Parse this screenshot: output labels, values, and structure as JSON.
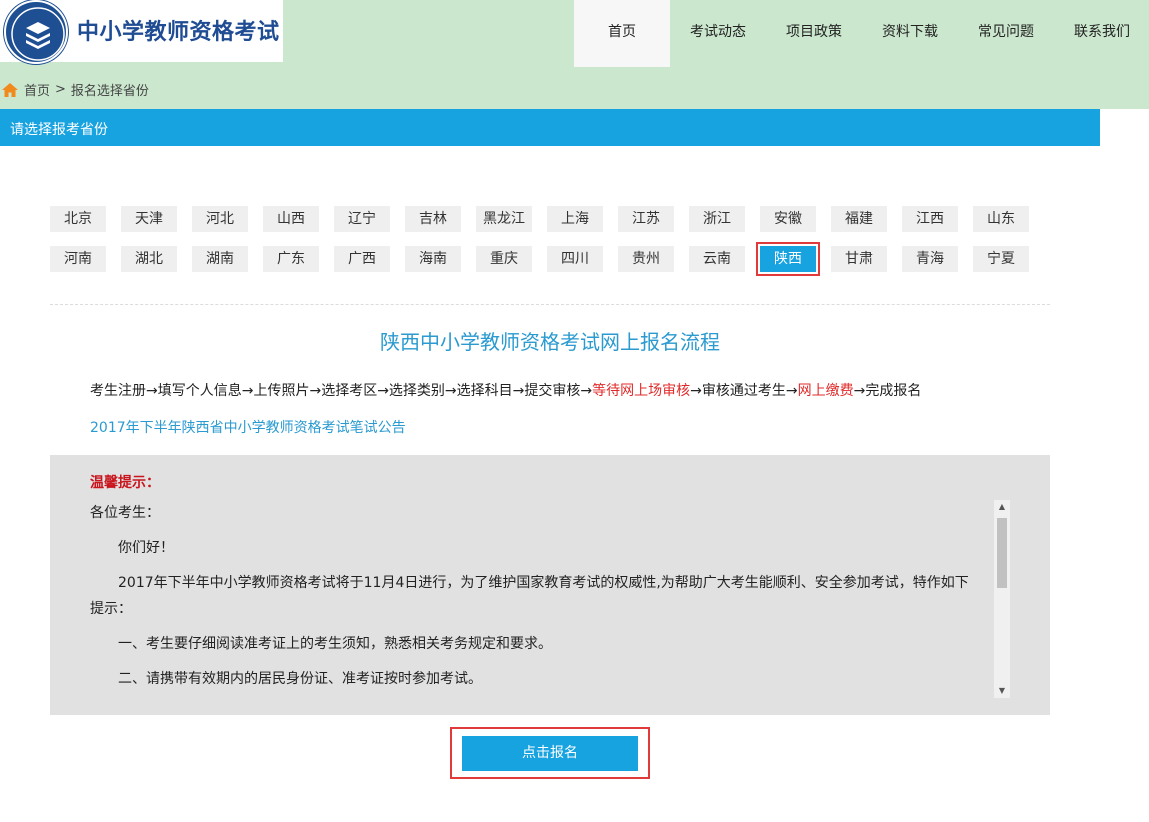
{
  "header": {
    "site_title": "中小学教师资格考试",
    "nav": [
      "首页",
      "考试动态",
      "项目政策",
      "资料下载",
      "常见问题",
      "联系我们"
    ],
    "active_nav": "首页"
  },
  "breadcrumb": {
    "home": "首页",
    "separator": ">",
    "current": "报名选择省份"
  },
  "section_title": "请选择报考省份",
  "provinces": {
    "row1": [
      "北京",
      "天津",
      "河北",
      "山西",
      "辽宁",
      "吉林",
      "黑龙江",
      "上海",
      "江苏",
      "浙江",
      "安徽",
      "福建",
      "江西",
      "山东"
    ],
    "row2": [
      "河南",
      "湖北",
      "湖南",
      "广东",
      "广西",
      "海南",
      "重庆",
      "四川",
      "贵州",
      "云南",
      "陕西",
      "甘肃",
      "青海",
      "宁夏"
    ],
    "selected": "陕西"
  },
  "flow": {
    "title": "陕西中小学教师资格考试网上报名流程",
    "steps_a": "考生注册→填写个人信息→上传照片→选择考区→选择类别→选择科目→提交审核→",
    "step_red_1": "等待网上场审核",
    "steps_b": "→审核通过考生→",
    "step_red_2": "网上缴费",
    "steps_c": "→完成报名"
  },
  "notice_link": "2017年下半年陕西省中小学教师资格考试笔试公告",
  "tips": {
    "title": "温馨提示：",
    "greeting": "各位考生：",
    "hello": "你们好！",
    "para1": "2017年下半年中小学教师资格考试将于11月4日进行，为了维护国家教育考试的权威性,为帮助广大考生能顺利、安全参加考试，特作如下提示：",
    "item1": "一、考生要仔细阅读准考证上的考生须知，熟悉相关考务规定和要求。",
    "item2": "二、请携带有效期内的居民身份证、准考证按时参加考试。"
  },
  "register_button": "点击报名",
  "colors": {
    "header_bg": "#cbe8cf",
    "brand_blue": "#1f4c93",
    "accent": "#17a2e0",
    "highlight_red": "#e02a2a",
    "box_bg": "#e1e1e1"
  }
}
